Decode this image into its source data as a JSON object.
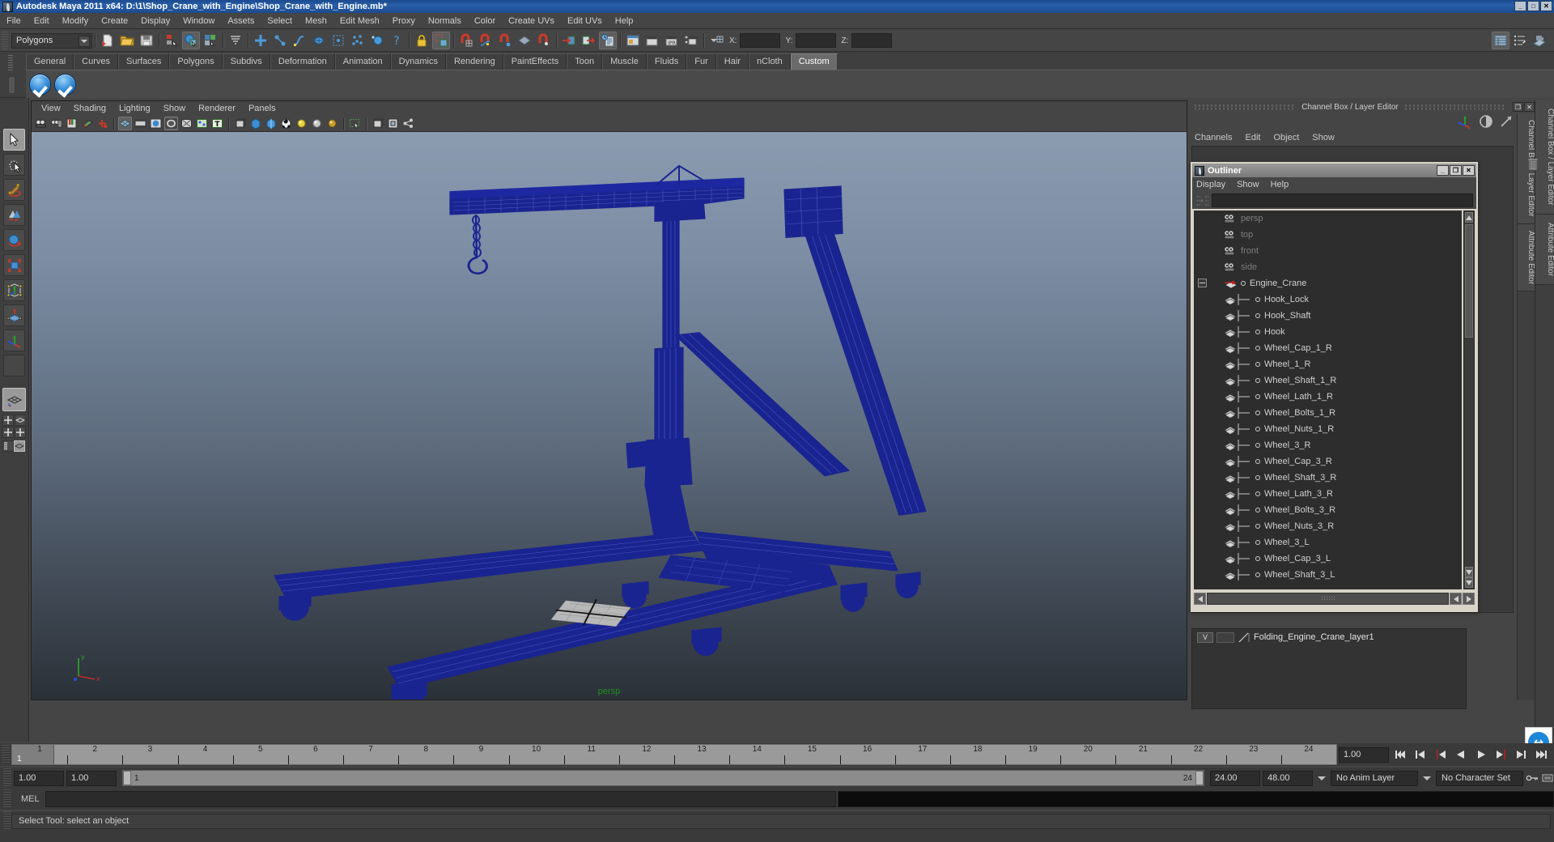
{
  "window": {
    "title": "Autodesk Maya 2011 x64: D:\\1\\Shop_Crane_with_Engine\\Shop_Crane_with_Engine.mb*",
    "minimize": "_",
    "maximize": "□",
    "close": "✕"
  },
  "menubar": {
    "items": [
      "File",
      "Edit",
      "Modify",
      "Create",
      "Display",
      "Window",
      "Assets",
      "Select",
      "Mesh",
      "Edit Mesh",
      "Proxy",
      "Normals",
      "Color",
      "Create UVs",
      "Edit UVs",
      "Help"
    ]
  },
  "statusline": {
    "mode": "Polygons",
    "axis": {
      "x_label": "X:",
      "y_label": "Y:",
      "z_label": "Z:",
      "x_value": "",
      "y_value": "",
      "z_value": ""
    }
  },
  "shelf": {
    "tabs": [
      "General",
      "Curves",
      "Surfaces",
      "Polygons",
      "Subdivs",
      "Deformation",
      "Animation",
      "Dynamics",
      "Rendering",
      "PaintEffects",
      "Toon",
      "Muscle",
      "Fluids",
      "Fur",
      "Hair",
      "nCloth",
      "Custom"
    ],
    "active_tab": "Custom",
    "buttons": [
      "check-blue-1",
      "check-blue-2"
    ]
  },
  "toolbox": {
    "tools": [
      {
        "name": "select-tool",
        "selected": true
      },
      {
        "name": "lasso-select-tool",
        "selected": false
      },
      {
        "name": "paint-select-tool",
        "selected": false
      },
      {
        "name": "move-tool",
        "selected": false
      },
      {
        "name": "rotate-tool",
        "selected": false
      },
      {
        "name": "scale-tool",
        "selected": false
      },
      {
        "name": "universal-manipulator-tool",
        "selected": false
      },
      {
        "name": "soft-modification-tool",
        "selected": false
      },
      {
        "name": "show-manipulator-tool",
        "selected": false
      },
      {
        "name": "last-tool-used",
        "selected": false
      }
    ],
    "layout_presets": [
      "single-perspective-view",
      "four-view",
      "two-pane-side",
      "two-pane-stacked",
      "outliner-persp",
      "hypergraph-persp"
    ]
  },
  "viewpanel": {
    "menus": [
      "View",
      "Shading",
      "Lighting",
      "Show",
      "Renderer",
      "Panels"
    ],
    "toolbar_icons": [
      "select-camera-icon",
      "camera-attributes-icon",
      "bookmark-icon",
      "image-plane-icon",
      "keyframe-icon",
      "wireframe-on-shaded-icon",
      "film-gate-icon",
      "resolution-gate-icon",
      "gate-mask-icon",
      "xray-icon",
      "xray-joints-icon",
      "text-icon",
      "shaded-wireframe-icon",
      "smooth-shade-icon",
      "smooth-shade-textured-icon",
      "texture-icon",
      "use-default-light-icon",
      "all-lights-icon",
      "shadows-icon",
      "isolate-select-icon",
      "x-ray-mode-icon",
      "grid-icon",
      "panel-icon",
      "share-icon"
    ],
    "camera_label": "persp",
    "axis_labels": {
      "x": "x",
      "y": "y",
      "z": "z"
    }
  },
  "scene": {
    "object": "Shop Crane with Engine (folding engine crane) wireframe",
    "wireframe_color": "#151f82",
    "background_top": "#8b9bb0",
    "background_bottom": "#2b3138"
  },
  "rightdock": {
    "title": "Channel Box / Layer Editor",
    "restore": "❐",
    "close": "✕",
    "vertical_tabs": [
      "Channel Box / Layer Editor",
      "Attribute Editor"
    ],
    "channel_menus": [
      "Channels",
      "Edit",
      "Object",
      "Show"
    ],
    "icons": [
      "manipulator-icon",
      "channel-display-icon",
      "attribute-icon"
    ]
  },
  "outliner": {
    "title": "Outliner",
    "window_buttons": {
      "minimize": "_",
      "maximize": "❐",
      "close": "✕"
    },
    "menus": [
      "Display",
      "Show",
      "Help"
    ],
    "search_value": "",
    "search_placeholder": "",
    "items": [
      {
        "label": "persp",
        "type": "camera",
        "indent": 1
      },
      {
        "label": "top",
        "type": "camera",
        "indent": 1
      },
      {
        "label": "front",
        "type": "camera",
        "indent": 1
      },
      {
        "label": "side",
        "type": "camera",
        "indent": 1
      },
      {
        "label": "Engine_Crane",
        "type": "group",
        "indent": 1,
        "expanded": true
      },
      {
        "label": "Hook_Lock",
        "type": "mesh",
        "indent": 2
      },
      {
        "label": "Hook_Shaft",
        "type": "mesh",
        "indent": 2
      },
      {
        "label": "Hook",
        "type": "mesh",
        "indent": 2
      },
      {
        "label": "Wheel_Cap_1_R",
        "type": "mesh",
        "indent": 2
      },
      {
        "label": "Wheel_1_R",
        "type": "mesh",
        "indent": 2
      },
      {
        "label": "Wheel_Shaft_1_R",
        "type": "mesh",
        "indent": 2
      },
      {
        "label": "Wheel_Lath_1_R",
        "type": "mesh",
        "indent": 2
      },
      {
        "label": "Wheel_Bolts_1_R",
        "type": "mesh",
        "indent": 2
      },
      {
        "label": "Wheel_Nuts_1_R",
        "type": "mesh",
        "indent": 2
      },
      {
        "label": "Wheel_3_R",
        "type": "mesh",
        "indent": 2
      },
      {
        "label": "Wheel_Cap_3_R",
        "type": "mesh",
        "indent": 2
      },
      {
        "label": "Wheel_Shaft_3_R",
        "type": "mesh",
        "indent": 2
      },
      {
        "label": "Wheel_Lath_3_R",
        "type": "mesh",
        "indent": 2
      },
      {
        "label": "Wheel_Bolts_3_R",
        "type": "mesh",
        "indent": 2
      },
      {
        "label": "Wheel_Nuts_3_R",
        "type": "mesh",
        "indent": 2
      },
      {
        "label": "Wheel_3_L",
        "type": "mesh",
        "indent": 2
      },
      {
        "label": "Wheel_Cap_3_L",
        "type": "mesh",
        "indent": 2
      },
      {
        "label": "Wheel_Shaft_3_L",
        "type": "mesh",
        "indent": 2
      }
    ]
  },
  "layereditor": {
    "layers": [
      {
        "visibility": "V",
        "playback": "",
        "name": "Folding_Engine_Crane_layer1"
      }
    ]
  },
  "timeslider": {
    "current_frame": "1",
    "ticks": [
      "1",
      "2",
      "3",
      "4",
      "5",
      "6",
      "7",
      "8",
      "9",
      "10",
      "11",
      "12",
      "13",
      "14",
      "15",
      "16",
      "17",
      "18",
      "19",
      "20",
      "21",
      "22",
      "23",
      "24"
    ],
    "current_time_field": "1.00",
    "playback_buttons": [
      "go-to-start-icon",
      "step-back-frame-icon",
      "step-back-key-icon",
      "play-backwards-icon",
      "play-forwards-icon",
      "step-forward-key-icon",
      "step-forward-frame-icon",
      "go-to-end-icon"
    ]
  },
  "rangeslider": {
    "anim_start": "1.00",
    "range_start": "1.00",
    "range_track_start": "1",
    "range_track_end": "24",
    "range_end": "24.00",
    "anim_end": "48.00",
    "anim_layer": "No Anim Layer",
    "character_set": "No Character Set"
  },
  "commandline": {
    "label": "MEL",
    "input_value": "",
    "output_value": ""
  },
  "helpline": {
    "text": "Select Tool: select an object"
  }
}
